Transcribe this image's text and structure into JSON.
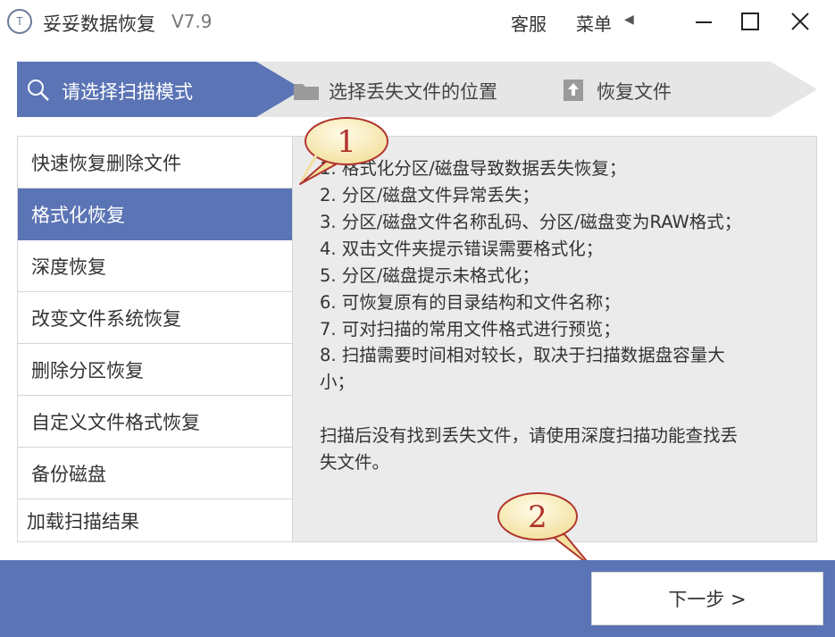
{
  "window": {
    "app_icon_text": "T",
    "title": "妥妥数据恢复",
    "version": "V7.9",
    "service": "客服",
    "menu": "菜单",
    "menu_arrow": "◀"
  },
  "steps": [
    {
      "label": "请选择扫描模式",
      "icon": "search-icon",
      "active": true
    },
    {
      "label": "选择丢失文件的位置",
      "icon": "folder-icon",
      "active": false
    },
    {
      "label": "恢复文件",
      "icon": "upload-icon",
      "active": false
    }
  ],
  "modes": [
    {
      "label": "快速恢复删除文件"
    },
    {
      "label": "格式化恢复"
    },
    {
      "label": "深度恢复"
    },
    {
      "label": "改变文件系统恢复"
    },
    {
      "label": "删除分区恢复"
    },
    {
      "label": "自定义文件格式恢复"
    },
    {
      "label": "备份磁盘"
    },
    {
      "label": "加载扫描结果"
    }
  ],
  "selected_mode_index": 1,
  "description": {
    "lines": [
      "1. 格式化分区/磁盘导致数据丢失恢复；",
      "2. 分区/磁盘文件异常丢失；",
      "3. 分区/磁盘文件名称乱码、分区/磁盘变为RAW格式；",
      "4. 双击文件夹提示错误需要格式化；",
      "5. 分区/磁盘提示未格式化；",
      "6. 可恢复原有的目录结构和文件名称；",
      "7. 可对扫描的常用文件格式进行预览；",
      "8. 扫描需要时间相对较长，取决于扫描数据盘容量大",
      "小；",
      "",
      "扫描后没有找到丢失文件，请使用深度扫描功能查找丢",
      "失文件。"
    ]
  },
  "callouts": [
    {
      "number": "1"
    },
    {
      "number": "2"
    }
  ],
  "footer": {
    "next_label": "下一步 >"
  },
  "colors": {
    "accent": "#5b74b5",
    "panel_bg": "#ebebeb",
    "callout_fill": "#fdf2c4",
    "callout_stroke": "#b0342c"
  }
}
